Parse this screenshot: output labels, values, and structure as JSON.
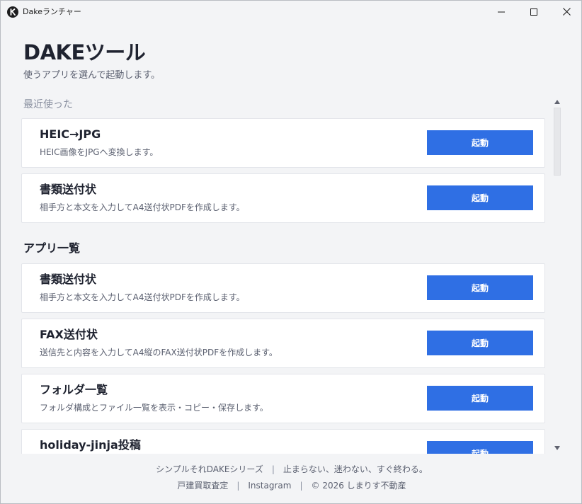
{
  "window": {
    "title": "Dakeランチャー"
  },
  "header": {
    "title": "DAKEツール",
    "subtitle": "使うアプリを選んで起動します。"
  },
  "recent": {
    "label": "最近使った",
    "items": [
      {
        "title": "HEIC→JPG",
        "desc": "HEIC画像をJPGへ変換します。",
        "button": "起動"
      },
      {
        "title": "書類送付状",
        "desc": "相手方と本文を入力してA4送付状PDFを作成します。",
        "button": "起動"
      }
    ]
  },
  "all": {
    "label": "アプリ一覧",
    "items": [
      {
        "title": "書類送付状",
        "desc": "相手方と本文を入力してA4送付状PDFを作成します。",
        "button": "起動"
      },
      {
        "title": "FAX送付状",
        "desc": "送信先と内容を入力してA4縦のFAX送付状PDFを作成します。",
        "button": "起動"
      },
      {
        "title": "フォルダ一覧",
        "desc": "フォルダ構成とファイル一覧を表示・コピー・保存します。",
        "button": "起動"
      },
      {
        "title": "holiday-jinja投稿",
        "desc": "",
        "button": "起動"
      }
    ]
  },
  "footer": {
    "series": "シンプルそれDAKEシリーズ",
    "separator": "|",
    "tagline": "止まらない、迷わない、すぐ終わる。",
    "link1": "戸建買取査定",
    "link2": "Instagram",
    "copyright": "© 2026 しまりす不動産"
  }
}
